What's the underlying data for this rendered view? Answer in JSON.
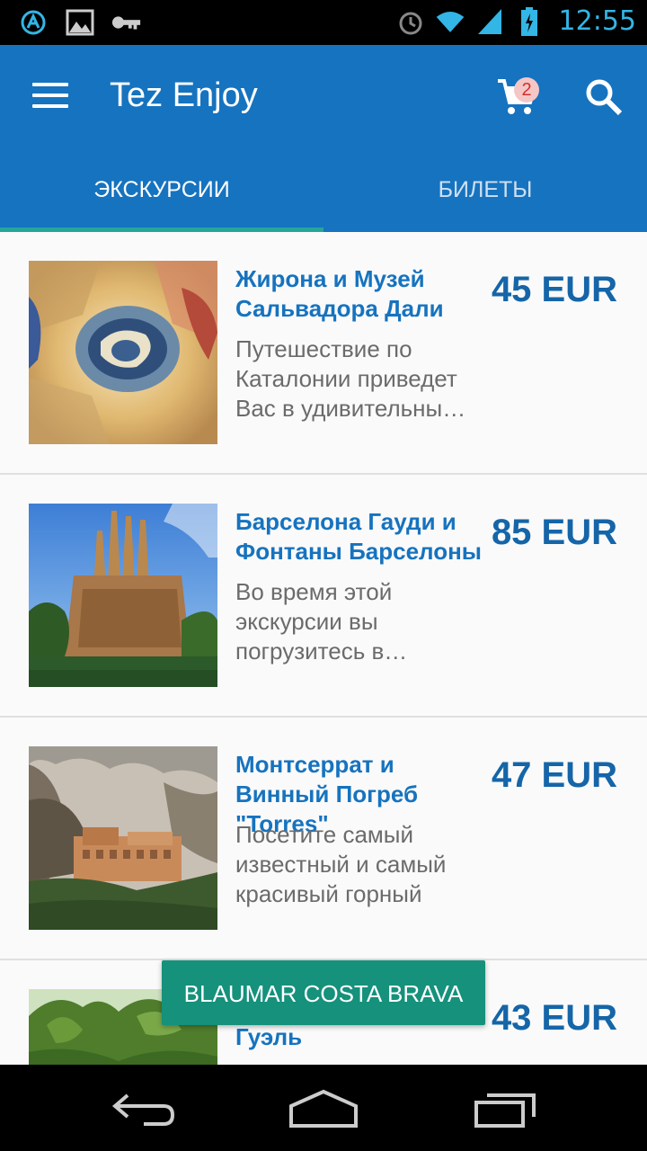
{
  "status_bar": {
    "time": "12:55",
    "left_icons": [
      "notification-a-icon",
      "image-icon",
      "key-icon"
    ],
    "right_icons": [
      "alarm-icon",
      "wifi-icon",
      "signal-icon",
      "battery-icon"
    ],
    "accent_color": "#33b5e5"
  },
  "app_bar": {
    "title": "Tez Enjoy",
    "cart_count": "2",
    "color": "#1673bf"
  },
  "tabs": [
    {
      "label": "ЭКСКУРСИИ",
      "active": true
    },
    {
      "label": "БИЛЕТЫ",
      "active": false
    }
  ],
  "tours": [
    {
      "title": " Жирона и Музей Сальвадора Дали",
      "price": "45 EUR",
      "description": "Путешествие по Каталонии приведет Вас в удивительны…",
      "image": "dali-ceiling-painting"
    },
    {
      "title": "Барселона Гауди и Фонтаны Барселоны",
      "price": "85 EUR",
      "description": "Во время этой экскурсии вы погрузитесь в…",
      "image": "sagrada-familia"
    },
    {
      "title": "Монтсеррат и Винный Погреб \"Torres\"",
      "price": "47 EUR",
      "description": "Посетите самый известный и самый красивый горный",
      "image": "montserrat-monastery"
    },
    {
      "title": "Барселона и Парк Гуэль",
      "price": "43 EUR",
      "description": "",
      "image": "park-palms"
    }
  ],
  "toast": {
    "text": "BLAUMAR COSTA BRAVA",
    "color": "#15917c"
  },
  "nav_bar": {
    "buttons": [
      "back-icon",
      "home-icon",
      "recent-apps-icon"
    ]
  }
}
